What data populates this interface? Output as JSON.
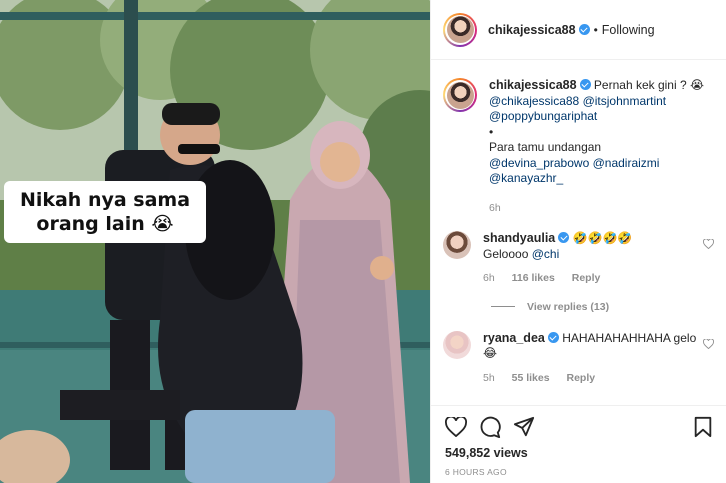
{
  "media": {
    "overlay_caption": "Nikah nya sama orang lain 😭"
  },
  "header": {
    "username": "chikajessica88",
    "separator": "•",
    "follow_status": "Following"
  },
  "caption": {
    "username": "chikajessica88",
    "text": "Pernah kek gini ? 😭",
    "mentions_line1": [
      "@chikajessica88",
      "@itsjohnmartint"
    ],
    "mentions_line2": "@poppybungariphat",
    "bullet": "•",
    "guests_label": "Para tamu undangan",
    "mentions_line3": [
      "@devina_prabowo",
      "@nadiraizmi"
    ],
    "mentions_line4": "@kanayazhr_",
    "time": "6h"
  },
  "comments": [
    {
      "username": "shandyaulia",
      "emojis": "🤣🤣🤣🤣",
      "text": "Geloooo",
      "mention": "@chi",
      "time": "6h",
      "likes": "116 likes",
      "reply": "Reply",
      "view_replies": "View replies (13)"
    },
    {
      "username": "ryana_dea",
      "text": "HAHAHAHAHHAHA gelo 😂",
      "time": "5h",
      "likes": "55 likes",
      "reply": "Reply"
    }
  ],
  "footer": {
    "views": "549,852 views",
    "time_ago": "6 HOURS AGO"
  },
  "icons": {
    "like": "heart-icon",
    "comment": "comment-icon",
    "share": "paper-plane-icon",
    "save": "bookmark-icon",
    "comment_like": "heart-outline-icon"
  },
  "colors": {
    "link": "#00376b",
    "verified": "#3897f0",
    "muted": "#8e8e8e"
  }
}
